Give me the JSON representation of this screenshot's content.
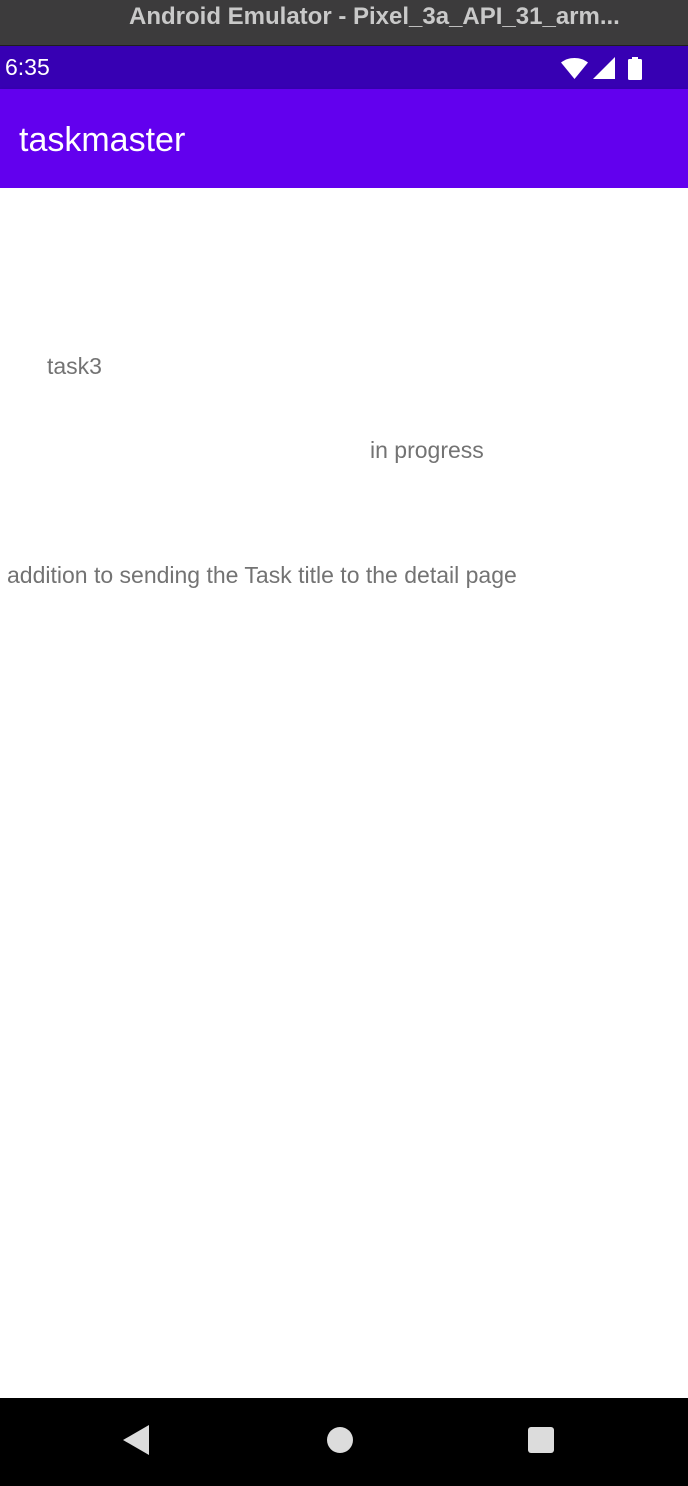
{
  "window": {
    "title": "Android Emulator - Pixel_3a_API_31_arm..."
  },
  "status_bar": {
    "time": "6:35",
    "icons": [
      "wifi-icon",
      "cell-signal-icon",
      "battery-icon"
    ],
    "color": "#3700b3"
  },
  "app_bar": {
    "title": "taskmaster",
    "color": "#6200ee"
  },
  "task": {
    "title": "task3",
    "state": "in progress",
    "body": "addition to sending the Task title to the detail page"
  },
  "nav_bar": {
    "buttons": [
      "back-icon",
      "home-icon",
      "recents-icon"
    ]
  }
}
